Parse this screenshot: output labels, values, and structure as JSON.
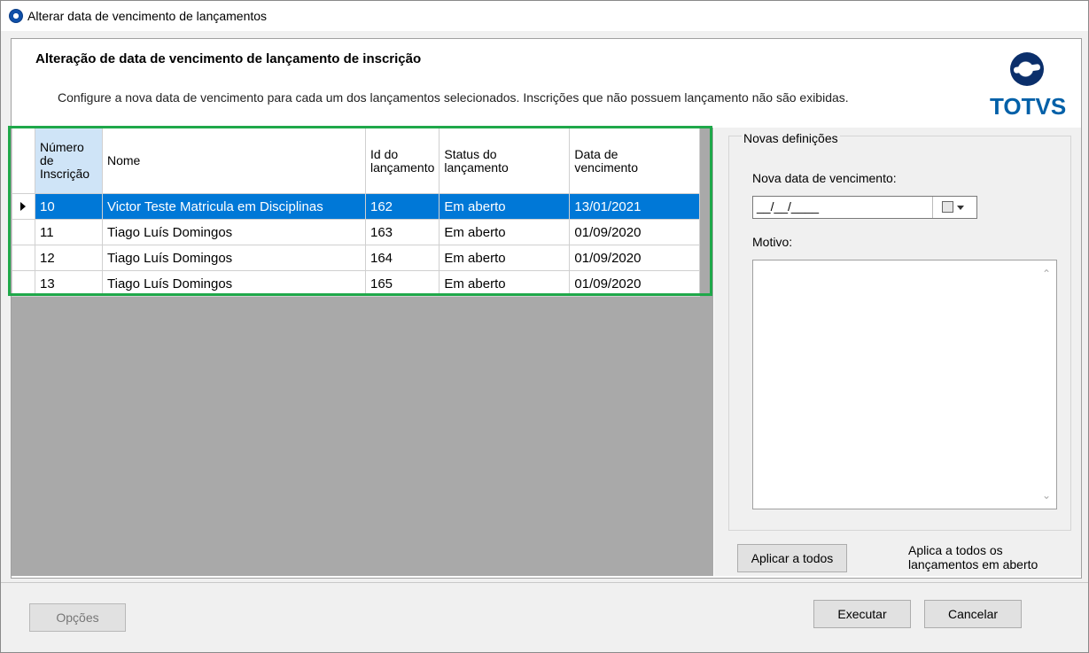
{
  "window": {
    "title": "Alterar data de vencimento de lançamentos"
  },
  "header": {
    "title": "Alteração de data de vencimento de lançamento de inscrição",
    "description": "Configure a nova data de vencimento para cada um dos lançamentos selecionados. Inscrições que não possuem lançamento não são exibidas.",
    "logo_text": "TOTVS"
  },
  "grid": {
    "columns": {
      "numero_line1": "Número",
      "numero_line2": "de",
      "numero_line3": "Inscrição",
      "nome": "Nome",
      "id_line1": "Id do",
      "id_line2": "lançamento",
      "status_line1": "Status do",
      "status_line2": "lançamento",
      "data_line1": "Data de",
      "data_line2": "vencimento"
    },
    "rows": [
      {
        "numero": "10",
        "nome": "Victor Teste Matricula em Disciplinas",
        "id": "162",
        "status": "Em aberto",
        "data": "13/01/2021"
      },
      {
        "numero": "11",
        "nome": "Tiago Luís Domingos",
        "id": "163",
        "status": "Em aberto",
        "data": "01/09/2020"
      },
      {
        "numero": "12",
        "nome": "Tiago Luís Domingos",
        "id": "164",
        "status": "Em aberto",
        "data": "01/09/2020"
      },
      {
        "numero": "13",
        "nome": "Tiago Luís Domingos",
        "id": "165",
        "status": "Em aberto",
        "data": "01/09/2020"
      }
    ]
  },
  "panel": {
    "group_title": "Novas definições",
    "date_label": "Nova data de vencimento:",
    "date_value": "__/__/____",
    "motivo_label": "Motivo:",
    "apply_button": "Aplicar a todos",
    "apply_help_line1": "Aplica a todos os",
    "apply_help_line2": "lançamentos em aberto"
  },
  "footer": {
    "options_button": "Opções",
    "execute_button": "Executar",
    "cancel_button": "Cancelar"
  },
  "colors": {
    "selection": "#0078d7",
    "highlight_box": "#1fa84a",
    "logo": "#0060a8"
  },
  "icons": [
    "app-icon",
    "row-pointer-icon",
    "calendar-icon",
    "dropdown-arrow-icon"
  ]
}
